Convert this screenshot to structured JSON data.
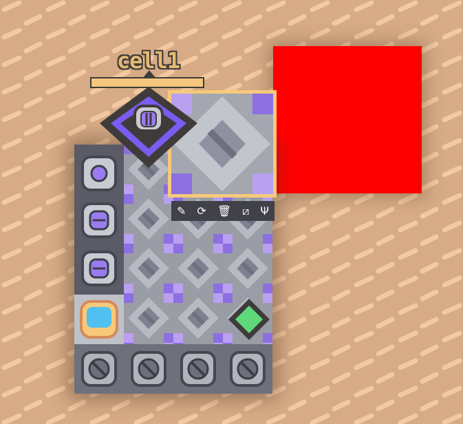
{
  "cell": {
    "label": "cell1",
    "accent_color": "#f6c97b"
  },
  "colors": {
    "background": "#d7ab86",
    "dash": "#f2c9a0",
    "red_panel": "#ff0000",
    "board_gray": "#8b8d98",
    "purple": "#7a5cf0",
    "gem_green": "#5fd87a"
  },
  "toolbar": {
    "tools": [
      {
        "icon": "pencil-icon",
        "glyph": "✎"
      },
      {
        "icon": "rotate-icon",
        "glyph": "⟳"
      },
      {
        "icon": "trash-icon",
        "glyph": "🗑"
      },
      {
        "icon": "slash-icon",
        "glyph": "⧄"
      },
      {
        "icon": "trident-icon",
        "glyph": "Ψ"
      }
    ]
  },
  "sidebar_slots": [
    {
      "icon": "circle-slot-icon"
    },
    {
      "icon": "bars-slot-icon"
    },
    {
      "icon": "bars-slot-icon"
    },
    {
      "icon": "blue-square-slot-icon"
    }
  ],
  "bottom_slots": [
    {
      "icon": "slash-slot-icon"
    },
    {
      "icon": "slash-slot-icon"
    },
    {
      "icon": "slash-slot-icon"
    },
    {
      "icon": "slash-slot-icon"
    }
  ]
}
